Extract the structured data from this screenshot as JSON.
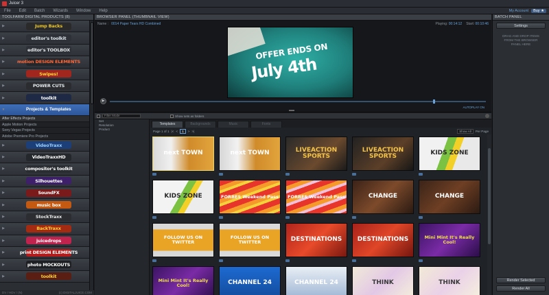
{
  "app": {
    "title": "Juicer 3"
  },
  "menu": {
    "items": [
      "File",
      "Edit",
      "Batch",
      "Wizards",
      "Window",
      "Help"
    ],
    "right": [
      "My Account",
      "Buy ★"
    ]
  },
  "products_panel": {
    "header": "TOOLFARM DIGITAL PRODUCTS (8)",
    "footer_left": "DV / HDV / (N)",
    "footer_right": "(c) DIGITALJUICE.COM",
    "items": [
      {
        "name": "Jump Backs",
        "color": "#e8c531",
        "bg": "#2a2a2a"
      },
      {
        "name": "editor's toolkit",
        "color": "#dde3ea",
        "bg": "#2e3238"
      },
      {
        "name": "editor's TOOLBOX",
        "color": "#e5e7ea",
        "bg": "#2e3238"
      },
      {
        "name": "motion DESIGN ELEMENTS",
        "color": "#ff6a3c",
        "bg": "#242629"
      },
      {
        "name": "Swipes!",
        "color": "#ffd23a",
        "bg": "#a0261e"
      },
      {
        "name": "POWER CUTS",
        "color": "#e4e8ec",
        "bg": "#2a2c2f"
      },
      {
        "name": "toolkit",
        "color": "#ffffff",
        "bg": "#1e2a45"
      },
      {
        "name": "Projects & Templates",
        "active": true
      },
      {
        "name": "VideoTraxx",
        "color": "#9ad0ff",
        "bg": "#1c3f79"
      },
      {
        "name": "VideoTraxxHD",
        "color": "#ffffff",
        "bg": "#24272b"
      },
      {
        "name": "compositor's toolkit",
        "color": "#ffffff",
        "bg": "#2a2d31"
      },
      {
        "name": "Silhouettes",
        "color": "#ffffff",
        "bg": "#3d1f6a"
      },
      {
        "name": "SoundFX",
        "color": "#ffffff",
        "bg": "#7a1a1a"
      },
      {
        "name": "music box",
        "color": "#ffffff",
        "bg": "#c45a12"
      },
      {
        "name": "StockTraxx",
        "color": "#e6e6e6",
        "bg": "#2b2d30"
      },
      {
        "name": "BackTraxx",
        "color": "#ffd23a",
        "bg": "#a22b12"
      },
      {
        "name": "juicedrops",
        "color": "#ffffff",
        "bg": "#c0234e"
      },
      {
        "name": "print DESIGN ELEMENTS",
        "color": "#ffffff",
        "bg": "#b21b1b"
      },
      {
        "name": "photo MOCKOUTS",
        "color": "#ffffff",
        "bg": "#1d1f22"
      },
      {
        "name": "toolkit",
        "color": "#ffd23a",
        "bg": "#5a1e12"
      }
    ],
    "subitems": [
      "After Effects Projects",
      "Apple Motion Projects",
      "Sony Vegas Projects",
      "Adobe Premiere Pro Projects"
    ]
  },
  "preview": {
    "header": "BROWSER PANEL (THUMBNAIL VIEW)",
    "name_label": "Name :",
    "name_value": "0014 Paper Tears HD Combined",
    "playing_label": "Playing:",
    "playing_value": "00:14:12",
    "start_label": "Start:",
    "start_value": "00:10:46",
    "video_line1": "OFFER ENDS ON",
    "video_line2": "July 4th",
    "autoplay": "AUTOPLAY ON",
    "progress": 0.86
  },
  "batch_panel": {
    "header": "BATCH PANEL",
    "settings": "Settings",
    "hint": "DRAG AND DROP ITEMS FROM THE BROWSER PANEL HERE",
    "render_selected": "Render Selected",
    "render_all": "Render All"
  },
  "browser": {
    "filter_placeholder": "Filter Mode",
    "show_folders": "Show sets as folders",
    "tree": [
      "Set",
      "Resolution",
      "Product"
    ],
    "tabs": [
      "Templates",
      "Backgrounds",
      "Music",
      "Fonts"
    ],
    "pager": {
      "label": "Page 1 of 1",
      "page": "1",
      "first": "|<",
      "prev": "<",
      "next": ">",
      "last": ">|",
      "show": "Show All",
      "per_page": "Per Page"
    },
    "templates": [
      {
        "label": "next TOWN",
        "fg": "#ffffff",
        "bg": "linear-gradient(90deg,#d9d9d9 0%,#f0f0f0 30%,#d08b2a 60%,#e2a43c 100%)"
      },
      {
        "label": "next TOWN",
        "fg": "#ffffff",
        "bg": "linear-gradient(90deg,#d6d6d6 0%,#f2f2f2 30%,#d08b2a 60%,#e2a43c 100%)"
      },
      {
        "label": "LIVEACTION SPORTS",
        "fg": "#f4c54a",
        "bg": "linear-gradient(135deg,#2a2a2a,#6b4a2e 60%,#1a1a1a)"
      },
      {
        "label": "LIVEACTION SPORTS",
        "fg": "#f4c54a",
        "bg": "linear-gradient(135deg,#222,#5c3f28 60%,#161616)"
      },
      {
        "label": "KIDS ZONE",
        "fg": "#2a2a2a",
        "bg": "linear-gradient(110deg,#f1f1f1 40%,#7bc142 40%,#7bc142 52%,#f3d027 52%,#f3d027 62%,#e9e9e9 62%)"
      },
      {
        "label": "KIDS ZONE",
        "fg": "#2a2a2a",
        "bg": "linear-gradient(120deg,#f3f3f3 45%,#7bc142 45%,#7bc142 55%,#f3d027 55%,#f3d027 63%,#ececec 63%)"
      },
      {
        "label": "FORBES Weekend Pass",
        "fg": "#ffffff",
        "bg": "repeating-linear-gradient(160deg,#e8352b 0 8px,#f59a2a 8px 14px,#f4d23c 14px 18px)"
      },
      {
        "label": "FORBES Weekend Pass",
        "fg": "#ffffff",
        "bg": "repeating-linear-gradient(160deg,#e8352b 0 8px,#f59a2a 8px 14px,#f2c0d8 14px 18px)"
      },
      {
        "label": "CHANGE",
        "fg": "#ffffff",
        "bg": "linear-gradient(135deg,#3a2218,#7d4a2b 50%,#2a1a12)"
      },
      {
        "label": "CHANGE",
        "fg": "#ffffff",
        "bg": "linear-gradient(135deg,#3b2418,#6e3f24 50%,#2b1a12)"
      },
      {
        "label": "FOLLOW US ON TWITTER",
        "fg": "#ffffff",
        "bg": "linear-gradient(180deg,#d8d8d8 0%,#d8d8d8 18%,#e9a325 18%,#e9a325 82%,#d8d8d8 82%)"
      },
      {
        "label": "FOLLOW US ON TWITTER",
        "fg": "#ffffff",
        "bg": "linear-gradient(180deg,#dadada 0%,#dadada 18%,#e9a325 18%,#e9a325 82%,#dadada 82%)"
      },
      {
        "label": "DESTINATIONS",
        "fg": "#ffffff",
        "bg": "linear-gradient(135deg,#b0241c,#e84a2a 50%,#7a1810)"
      },
      {
        "label": "DESTINATIONS",
        "fg": "#ffffff",
        "bg": "linear-gradient(135deg,#a8221a,#e04628 50%,#74160f)"
      },
      {
        "label": "Mini Mint It's Really Cool!",
        "fg": "#f2e04a",
        "bg": "linear-gradient(135deg,#3c1463,#7a2ba6 50%,#2a0d48)"
      },
      {
        "label": "Mini Mint It's Really Cool!",
        "fg": "#f2e04a",
        "bg": "linear-gradient(135deg,#3c1463,#7a2ba6 50%,#2a0d48)"
      },
      {
        "label": "CHANNEL 24",
        "fg": "#ffffff",
        "bg": "linear-gradient(180deg,#1d6ad1,#124a9a)"
      },
      {
        "label": "CHANNEL 24",
        "fg": "#ffffff",
        "bg": "linear-gradient(180deg,#e8eef5,#9bb3d2)"
      },
      {
        "label": "THINK",
        "fg": "#3a3a3a",
        "bg": "linear-gradient(135deg,#f0e9d8,#e3c8e6 50%,#f6f0dc)"
      },
      {
        "label": "THINK",
        "fg": "#3a3a3a",
        "bg": "linear-gradient(135deg,#f2ead6,#ead1e8 50%,#f6f1de)"
      }
    ]
  },
  "colors": {
    "accent": "#3f6fb8",
    "link": "#6aa1d6",
    "panel": "#2b2e33"
  }
}
